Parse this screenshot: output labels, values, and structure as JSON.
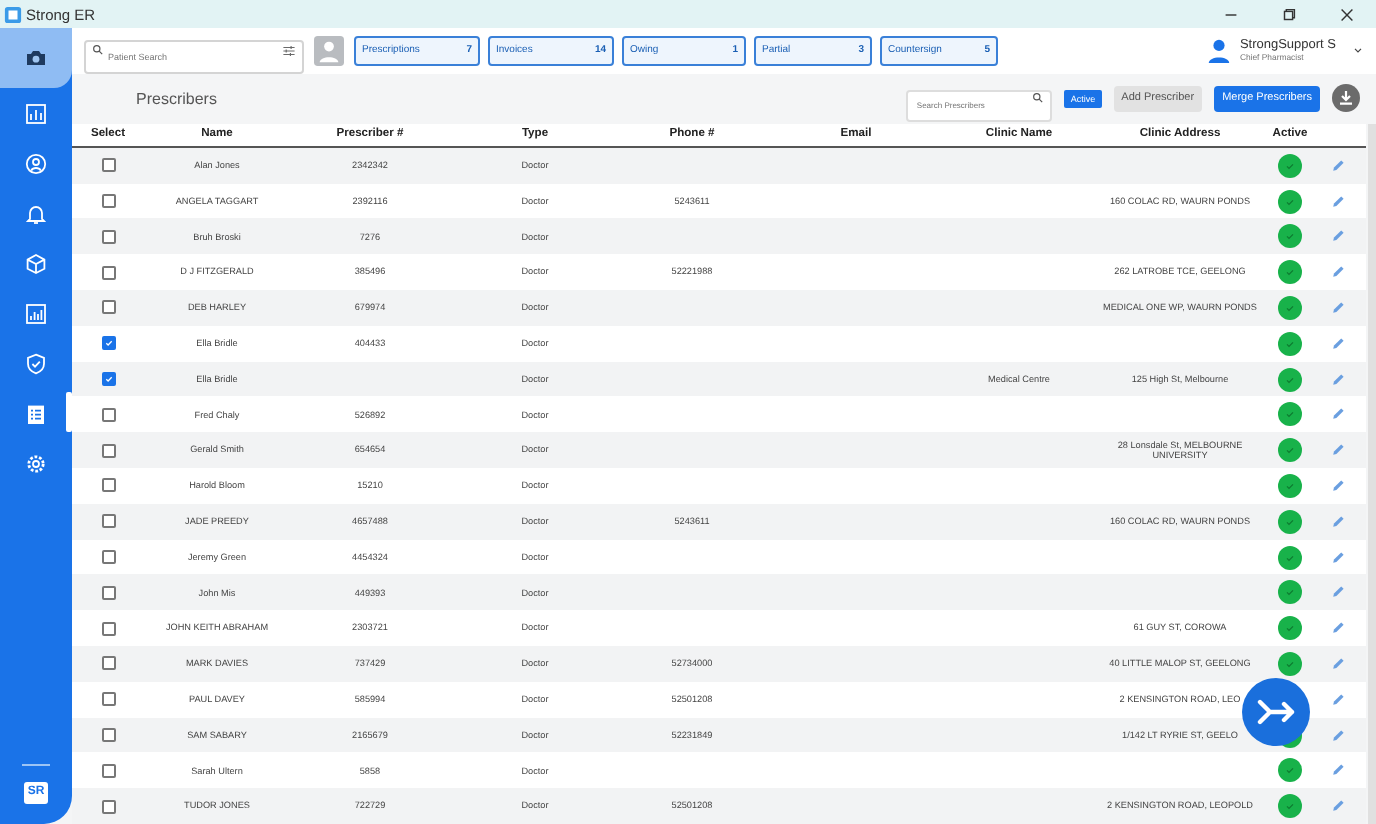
{
  "window": {
    "title": "Strong ER"
  },
  "sidebar": {
    "items": [
      {
        "kind": "camera",
        "selected": true,
        "indicator": false
      },
      {
        "kind": "chart",
        "selected": false,
        "indicator": false
      },
      {
        "kind": "person",
        "selected": false,
        "indicator": false
      },
      {
        "kind": "bell",
        "selected": false,
        "indicator": false
      },
      {
        "kind": "cube",
        "selected": false,
        "indicator": false
      },
      {
        "kind": "bars",
        "selected": false,
        "indicator": false
      },
      {
        "kind": "shield",
        "selected": false,
        "indicator": false
      },
      {
        "kind": "clipboard",
        "selected": false,
        "indicator": true
      },
      {
        "kind": "gear",
        "selected": false,
        "indicator": false
      }
    ],
    "logo": "SR"
  },
  "search": {
    "placeholder": "Patient Search"
  },
  "tabs": [
    {
      "label": "Prescriptions",
      "count": "7"
    },
    {
      "label": "Invoices",
      "count": "14"
    },
    {
      "label": "Owing",
      "count": "1"
    },
    {
      "label": "Partial",
      "count": "3"
    },
    {
      "label": "Countersign",
      "count": "5"
    }
  ],
  "user": {
    "name": "StrongSupport S",
    "role": "Chief Pharmacist"
  },
  "page": {
    "title": "Prescribers",
    "search_placeholder": "Search Prescribers",
    "filter_badge": "Active",
    "buttons": [
      {
        "label": "Add Prescriber",
        "kind": "secondary"
      },
      {
        "label": "Merge Prescribers",
        "kind": "primary"
      }
    ]
  },
  "table": {
    "columns": [
      "Select",
      "Name",
      "Prescriber #",
      "Type",
      "Phone #",
      "Email",
      "Clinic Name",
      "Clinic Address",
      "Active"
    ],
    "rows": [
      {
        "selected": false,
        "name": "Alan Jones",
        "number": "2342342",
        "type": "Doctor",
        "active": true
      },
      {
        "selected": false,
        "name": "ANGELA TAGGART",
        "number": "2392116",
        "type": "Doctor",
        "phone": "5243611",
        "address": "160 COLAC RD, WAURN PONDS",
        "active": true
      },
      {
        "selected": false,
        "name": "Bruh Broski",
        "number": "7276",
        "type": "Doctor",
        "active": true
      },
      {
        "selected": false,
        "name": "D J FITZGERALD",
        "number": "385496",
        "type": "Doctor",
        "phone": "52221988",
        "address": "262 LATROBE TCE, GEELONG",
        "active": true
      },
      {
        "selected": false,
        "name": "DEB HARLEY",
        "number": "679974",
        "type": "Doctor",
        "address": "MEDICAL ONE WP, WAURN PONDS",
        "active": true
      },
      {
        "selected": true,
        "name": "Ella Bridle",
        "number": "404433",
        "type": "Doctor",
        "active": true
      },
      {
        "selected": true,
        "name": "Ella Bridle",
        "type": "Doctor",
        "clinic": "Medical Centre",
        "address": "125 High St, Melbourne",
        "active": true
      },
      {
        "selected": false,
        "name": "Fred Chaly",
        "number": "526892",
        "type": "Doctor",
        "active": true
      },
      {
        "selected": false,
        "name": "Gerald Smith",
        "number": "654654",
        "type": "Doctor",
        "address": "28 Lonsdale St, MELBOURNE UNIVERSITY",
        "active": true
      },
      {
        "selected": false,
        "name": "Harold Bloom",
        "number": "15210",
        "type": "Doctor",
        "active": true
      },
      {
        "selected": false,
        "name": "JADE PREEDY",
        "number": "4657488",
        "type": "Doctor",
        "phone": "5243611",
        "address": "160 COLAC RD, WAURN PONDS",
        "active": true
      },
      {
        "selected": false,
        "name": "Jeremy Green",
        "number": "4454324",
        "type": "Doctor",
        "active": true
      },
      {
        "selected": false,
        "name": "John Mis",
        "number": "449393",
        "type": "Doctor",
        "active": true
      },
      {
        "selected": false,
        "name": "JOHN KEITH ABRAHAM",
        "number": "2303721",
        "type": "Doctor",
        "address": "61 GUY ST, COROWA",
        "active": true
      },
      {
        "selected": false,
        "name": "MARK DAVIES",
        "number": "737429",
        "type": "Doctor",
        "phone": "52734000",
        "address": "40 LITTLE MALOP ST, GEELONG",
        "active": true
      },
      {
        "selected": false,
        "name": "PAUL DAVEY",
        "number": "585994",
        "type": "Doctor",
        "phone": "52501208",
        "address": "2 KENSINGTON ROAD, LEO"
      },
      {
        "selected": false,
        "name": "SAM SABARY",
        "number": "2165679",
        "type": "Doctor",
        "phone": "52231849",
        "address": "1/142 LT RYRIE ST, GEELO",
        "active": true
      },
      {
        "selected": false,
        "name": "Sarah Ultern",
        "number": "5858",
        "type": "Doctor",
        "active": true
      },
      {
        "selected": false,
        "name": "TUDOR JONES",
        "number": "722729",
        "type": "Doctor",
        "phone": "52501208",
        "address": "2 KENSINGTON ROAD, LEOPOLD",
        "active": true
      }
    ]
  }
}
